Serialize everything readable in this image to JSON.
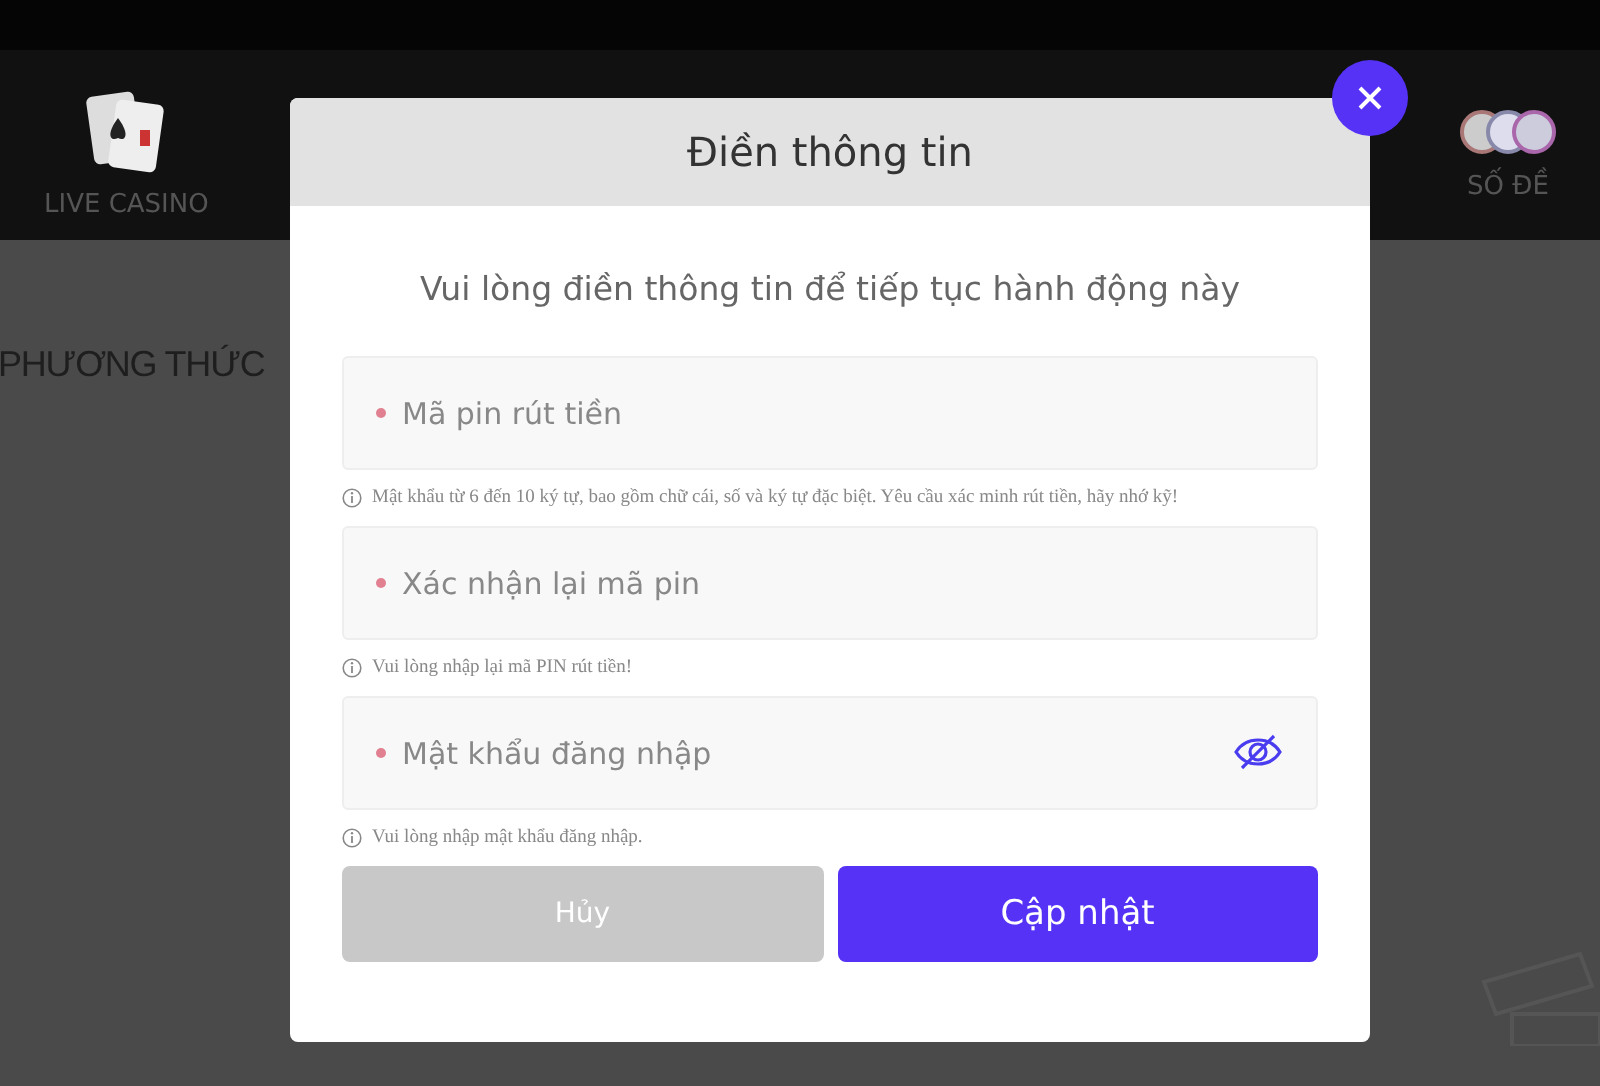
{
  "nav": [
    {
      "label": "LIVE CASINO",
      "kind": "cards"
    },
    {
      "label": "SỐ ĐỀ",
      "kind": "balls"
    }
  ],
  "page_heading": "PHƯƠNG THỨC",
  "dialog": {
    "title": "Điền thông tin",
    "subtitle": "Vui lòng điền thông tin để tiếp tục hành động này",
    "fields": [
      {
        "placeholder": "Mã pin rút tiền",
        "required": true,
        "visibility_toggle": false,
        "hint": "Mật khẩu từ 6 đến 10 ký tự, bao gồm chữ cái, số và ký tự đặc biệt. Yêu cầu xác minh rút tiền, hãy nhớ kỹ!"
      },
      {
        "placeholder": "Xác nhận lại mã pin",
        "required": true,
        "visibility_toggle": false,
        "hint": "Vui lòng nhập lại mã PIN rút tiền!"
      },
      {
        "placeholder": "Mật khẩu đăng nhập",
        "required": true,
        "visibility_toggle": true,
        "hint": "Vui lòng nhập mật khẩu đăng nhập."
      }
    ],
    "buttons": [
      {
        "label": "Hủy",
        "kind": "cancel"
      },
      {
        "label": "Cập nhật",
        "kind": "primary"
      }
    ]
  }
}
